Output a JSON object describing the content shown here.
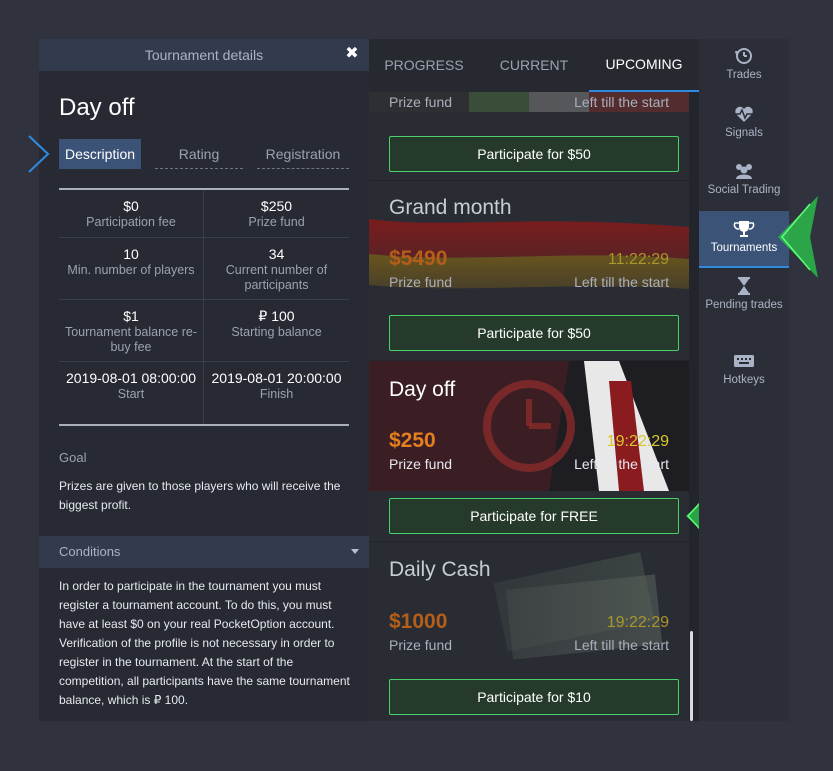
{
  "details": {
    "header_title": "Tournament details",
    "title": "Day off",
    "subtabs": [
      "Description",
      "Rating",
      "Registration"
    ],
    "stats": [
      {
        "value": "$0",
        "label": "Participation fee"
      },
      {
        "value": "$250",
        "label": "Prize fund"
      },
      {
        "value": "10",
        "label": "Min. number of players"
      },
      {
        "value": "34",
        "label": "Current number of participants"
      },
      {
        "value": "$1",
        "label": "Tournament balance re-buy fee"
      },
      {
        "value": "₽ 100",
        "label": "Starting balance"
      },
      {
        "value": "2019-08-01 08:00:00",
        "label": "Start"
      },
      {
        "value": "2019-08-01 20:00:00",
        "label": "Finish"
      }
    ],
    "goal_title": "Goal",
    "goal_text": "Prizes are given to those players who will receive the biggest profit.",
    "conditions_title": "Conditions",
    "conditions_text": "In order to participate in the tournament you must register a tournament account. To do this, you must have at least $0 on your real PocketOption account. Verification of the profile is not necessary in order to register in the tournament. At the start of the competition, all participants have the same tournament balance, which is ₽ 100."
  },
  "tabs": [
    "PROGRESS",
    "CURRENT",
    "UPCOMING"
  ],
  "cards": [
    {
      "name": "",
      "amount": "",
      "timer": "",
      "prize_label": "Prize fund",
      "time_label": "Left till the start",
      "button": "Participate for $50"
    },
    {
      "name": "Grand month",
      "amount": "$5490",
      "timer": "11:22:29",
      "prize_label": "Prize fund",
      "time_label": "Left till the start",
      "button": "Participate for $50"
    },
    {
      "name": "Day off",
      "amount": "$250",
      "timer": "19:22:29",
      "prize_label": "Prize fund",
      "time_label": "Left till the start",
      "button": "Participate for FREE"
    },
    {
      "name": "Daily Cash",
      "amount": "$1000",
      "timer": "19:22:29",
      "prize_label": "Prize fund",
      "time_label": "Left till the start",
      "button": "Participate for $10"
    }
  ],
  "sidebar": {
    "items": [
      {
        "label": "Trades",
        "icon": "history-icon"
      },
      {
        "label": "Signals",
        "icon": "heartbeat-icon"
      },
      {
        "label": "Social Trading",
        "icon": "users-icon"
      },
      {
        "label": "Tournaments",
        "icon": "trophy-icon"
      },
      {
        "label": "Pending trades",
        "icon": "hourglass-icon"
      },
      {
        "label": "Hotkeys",
        "icon": "keyboard-icon"
      }
    ]
  },
  "colors": {
    "accent_blue": "#2f8ae0",
    "button_border_green": "#49d26c",
    "amount_orange": "#e57e1e",
    "timer_yellow": "#c6b52a",
    "arrow_green": "#3fcf5a",
    "arrow_blue": "#2f8ae0"
  }
}
